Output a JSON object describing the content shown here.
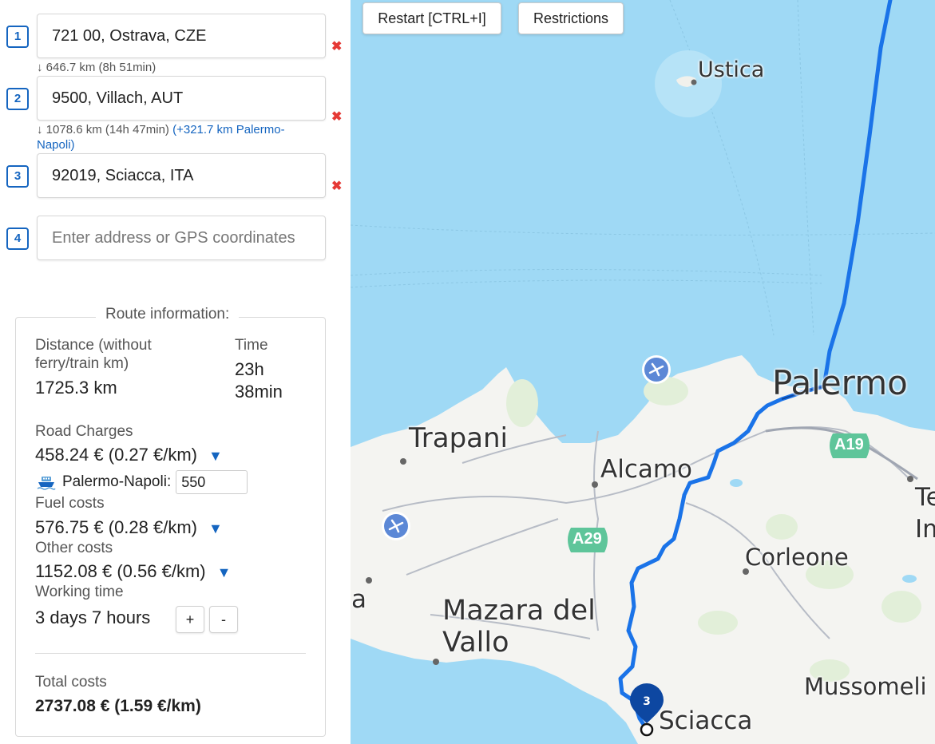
{
  "waypoints": [
    {
      "num": "1",
      "value": "721 00, Ostrava, CZE",
      "delete": "✖"
    },
    {
      "num": "2",
      "value": "9500, Villach, AUT",
      "delete": "✖"
    },
    {
      "num": "3",
      "value": "92019, Sciacca, ITA",
      "delete": "✖"
    },
    {
      "num": "4",
      "value": "",
      "placeholder": "Enter address or GPS coordinates"
    }
  ],
  "segments": [
    {
      "text": "↓ 646.7 km (8h 51min)"
    },
    {
      "text": "↓ 1078.6 km (14h 47min)",
      "ferry_line1": "(+321.7 km Palermo-",
      "ferry_line2": "Napoli)"
    }
  ],
  "route_info": {
    "title": "Route information:",
    "distance_label_1": "Distance (without",
    "distance_label_2": "ferry/train km)",
    "distance_value": "1725.3 km",
    "time_label": "Time",
    "time_value_1": "23h",
    "time_value_2": "38min",
    "road_charges_label": "Road Charges",
    "road_charges_value": "458.24 € (0.27 €/km)",
    "ferry_label": "Palermo-Napoli:",
    "ferry_value": "550",
    "fuel_label": "Fuel costs",
    "fuel_value": "576.75 € (0.28 €/km)",
    "other_label": "Other costs",
    "other_value": "1152.08 € (0.56 €/km)",
    "working_label": "Working time",
    "working_value": "3 days 7 hours",
    "plus": "+",
    "minus": "-",
    "total_label": "Total costs",
    "total_value": "2737.08 € (1.59 €/km)",
    "expand_icon": "▼"
  },
  "map": {
    "restart_label": "Restart [CTRL+I]",
    "restrictions_label": "Restrictions",
    "marker_num": "3",
    "cities": {
      "ustica": "Ustica",
      "palermo": "Palermo",
      "trapani": "Trapani",
      "alcamo": "Alcamo",
      "corleone": "Corleone",
      "mazara1": "Mazara del",
      "mazara2": "Vallo",
      "sciacca": "Sciacca",
      "mussomeli": "Mussomeli",
      "edge_te": "Te",
      "edge_im": "Im",
      "edge_a": "a"
    },
    "roads": {
      "a29": "A29",
      "a19": "A19"
    },
    "colors": {
      "sea": "#9fd9f5",
      "land": "#f4f4f1",
      "route": "#1a73e8",
      "marker": "#0d47a1"
    }
  }
}
